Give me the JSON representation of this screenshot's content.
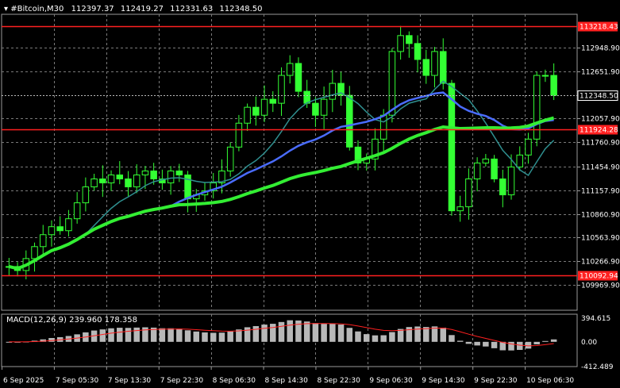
{
  "header": {
    "symbol": "#Bitcoin,M30",
    "open": "112397.37",
    "high": "112419.27",
    "low": "112331.63",
    "close": "112348.50"
  },
  "colors": {
    "background": "#000000",
    "grid": "#7a7a7a",
    "candle": "#33ff33",
    "ma_fast": "#2f8f8f",
    "ma_mid": "#4a6cff",
    "ma_slow": "#33ee33",
    "hline": "#ff2020",
    "macd_hist": "#b8b8b8",
    "macd_signal": "#ff2020"
  },
  "price_axis": {
    "ticks": [
      "112948.90",
      "112651.90",
      "112057.90",
      "111760.90",
      "111454.90",
      "111157.90",
      "110860.90",
      "110563.90",
      "110266.90",
      "109969.90"
    ],
    "tick_values": [
      112948.9,
      112651.9,
      112057.9,
      111760.9,
      111454.9,
      111157.9,
      110860.9,
      110563.9,
      110266.9,
      109969.9
    ],
    "current_label": "112348.50",
    "current_value": 112348.5
  },
  "levels": [
    {
      "label": "113218.43",
      "value": 113218.43
    },
    {
      "label": "111924.28",
      "value": 111924.28
    },
    {
      "label": "110092.94",
      "value": 110092.94
    }
  ],
  "time_axis": {
    "labels": [
      "6 Sep 2025",
      "7 Sep 05:30",
      "7 Sep 13:30",
      "7 Sep 22:30",
      "8 Sep 06:30",
      "8 Sep 14:30",
      "8 Sep 22:30",
      "9 Sep 06:30",
      "9 Sep 14:30",
      "9 Sep 22:30",
      "10 Sep 06:30"
    ]
  },
  "macd": {
    "title": "MACD(12,26,9) 239.960 178.358",
    "ticks": [
      "394.615",
      "0.00",
      "-412.489"
    ],
    "tick_values": [
      394.615,
      0,
      -412.489
    ]
  },
  "chart_data": {
    "type": "candlestick",
    "ylim": [
      109900,
      113350
    ],
    "series": [
      {
        "name": "#Bitcoin,M30",
        "kind": "close",
        "values": [
          110200,
          110150,
          110300,
          110450,
          110600,
          110700,
          110650,
          110800,
          111000,
          111200,
          111300,
          111250,
          111350,
          111300,
          111200,
          111350,
          111400,
          111300,
          111250,
          111400,
          111350,
          111050,
          111100,
          111150,
          111250,
          111400,
          111700,
          112000,
          112200,
          112100,
          112300,
          112250,
          112600,
          112750,
          112400,
          112250,
          112100,
          112300,
          112500,
          112350,
          111700,
          111500,
          111550,
          111800,
          112100,
          112900,
          113100,
          113000,
          112800,
          112600,
          112900,
          112500,
          110900,
          110950,
          111300,
          111500,
          111550,
          111300,
          111100,
          111450,
          111600,
          111800,
          112600,
          112600,
          112350
        ]
      }
    ]
  }
}
